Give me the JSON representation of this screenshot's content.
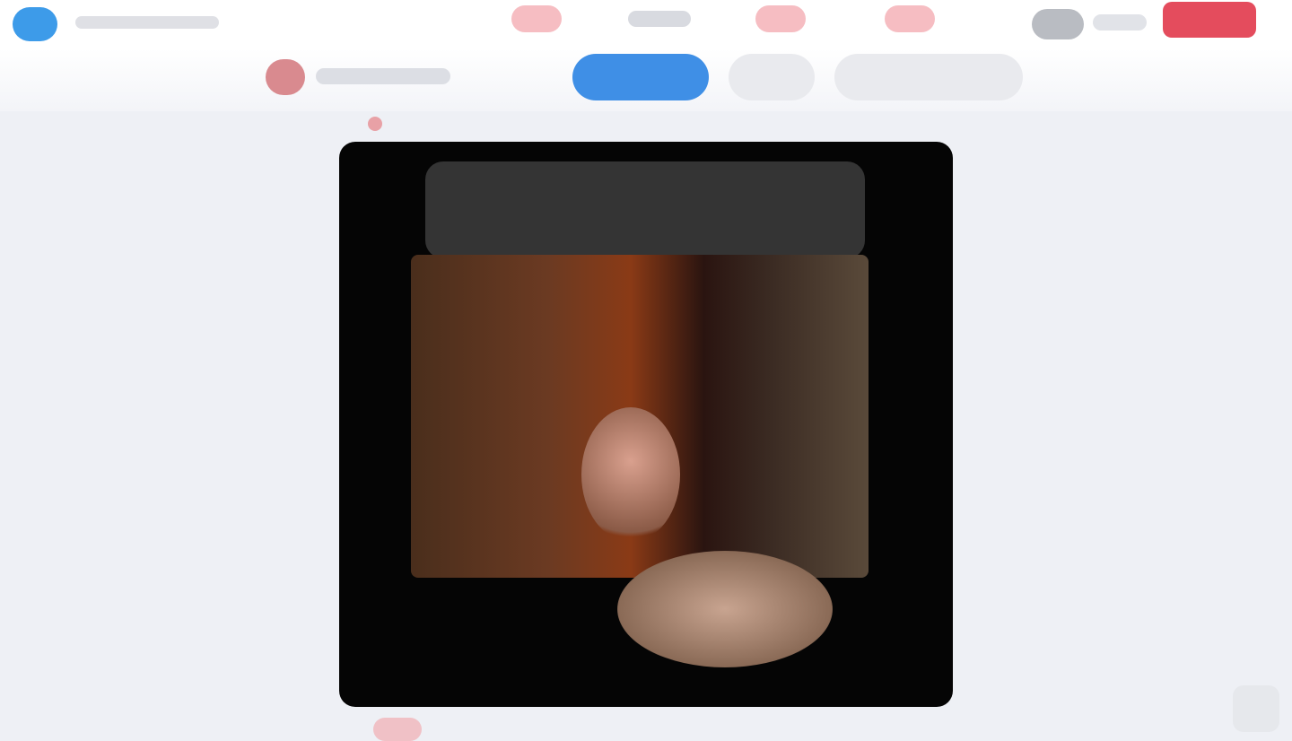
{
  "brand": {
    "color": "#3d9be9",
    "site_name": ""
  },
  "topbar": {
    "nav_items": [
      "",
      "",
      "",
      ""
    ],
    "pro_button_label": ""
  },
  "subbar": {
    "channel_label": "",
    "tabs": [
      {
        "label": "",
        "active": true
      },
      {
        "label": "",
        "active": false
      },
      {
        "label": "",
        "active": false
      }
    ]
  },
  "post": {
    "top_text": "",
    "caption": ""
  },
  "colors": {
    "accent": "#3f8fe6",
    "danger": "#e1394b",
    "background": "#eef0f5"
  }
}
